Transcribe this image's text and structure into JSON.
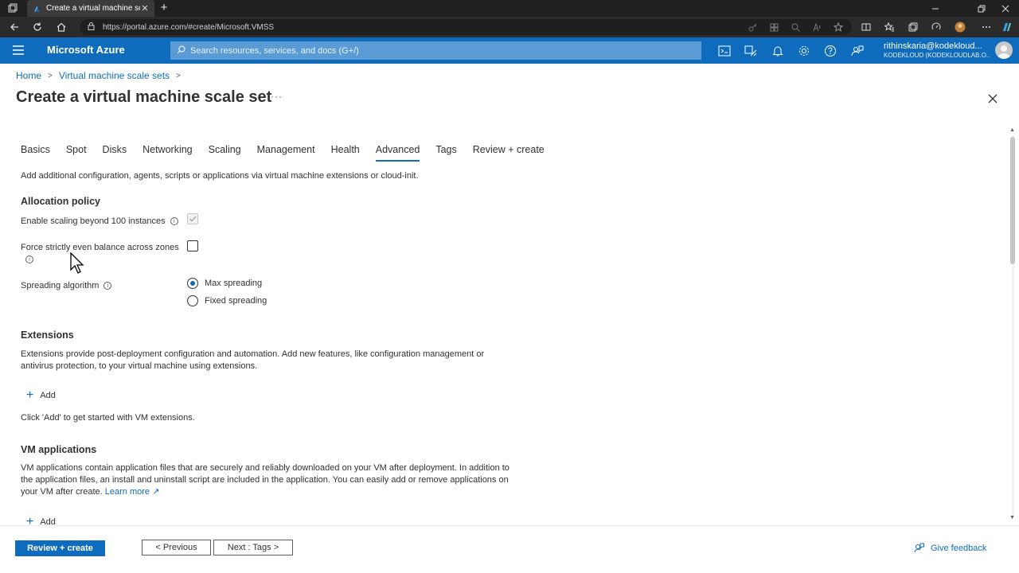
{
  "browser": {
    "tab_title": "Create a virtual machine scale se",
    "url": "https://portal.azure.com/#create/Microsoft.VMSS"
  },
  "azure": {
    "brand": "Microsoft Azure",
    "search_placeholder": "Search resources, services, and docs (G+/)",
    "user": "rithinskaria@kodekloud...",
    "directory": "KODEKLOUD (KODEKLOUDLAB.O..."
  },
  "breadcrumb": {
    "home": "Home",
    "vmss": "Virtual machine scale sets"
  },
  "page": {
    "title": "Create a virtual machine scale set",
    "ellipsis": "···"
  },
  "tabs": [
    {
      "label": "Basics"
    },
    {
      "label": "Spot"
    },
    {
      "label": "Disks"
    },
    {
      "label": "Networking"
    },
    {
      "label": "Scaling"
    },
    {
      "label": "Management"
    },
    {
      "label": "Health"
    },
    {
      "label": "Advanced"
    },
    {
      "label": "Tags"
    },
    {
      "label": "Review + create"
    }
  ],
  "advanced": {
    "description": "Add additional configuration, agents, scripts or applications via virtual machine extensions or cloud-init.",
    "allocation_policy": {
      "heading": "Allocation policy",
      "enable_scaling_label": "Enable scaling beyond 100 instances",
      "force_balance_label": "Force strictly even balance across zones",
      "spreading_label": "Spreading algorithm",
      "max_spreading": "Max spreading",
      "fixed_spreading": "Fixed spreading"
    },
    "extensions": {
      "heading": "Extensions",
      "description": "Extensions provide post-deployment configuration and automation. Add new features, like configuration management or antivirus protection, to your virtual machine using extensions.",
      "add_label": "Add",
      "hint": "Click 'Add' to get started with VM extensions."
    },
    "vm_applications": {
      "heading": "VM applications",
      "description": "VM applications contain application files that are securely and reliably downloaded on your VM after deployment. In addition to the application files, an install and uninstall script are included in the application. You can easily add or remove applications on your VM after create.",
      "learn_more": "Learn more",
      "add_label": "Add"
    }
  },
  "footer": {
    "review_create": "Review + create",
    "previous": "< Previous",
    "next": "Next : Tags >",
    "feedback": "Give feedback"
  }
}
